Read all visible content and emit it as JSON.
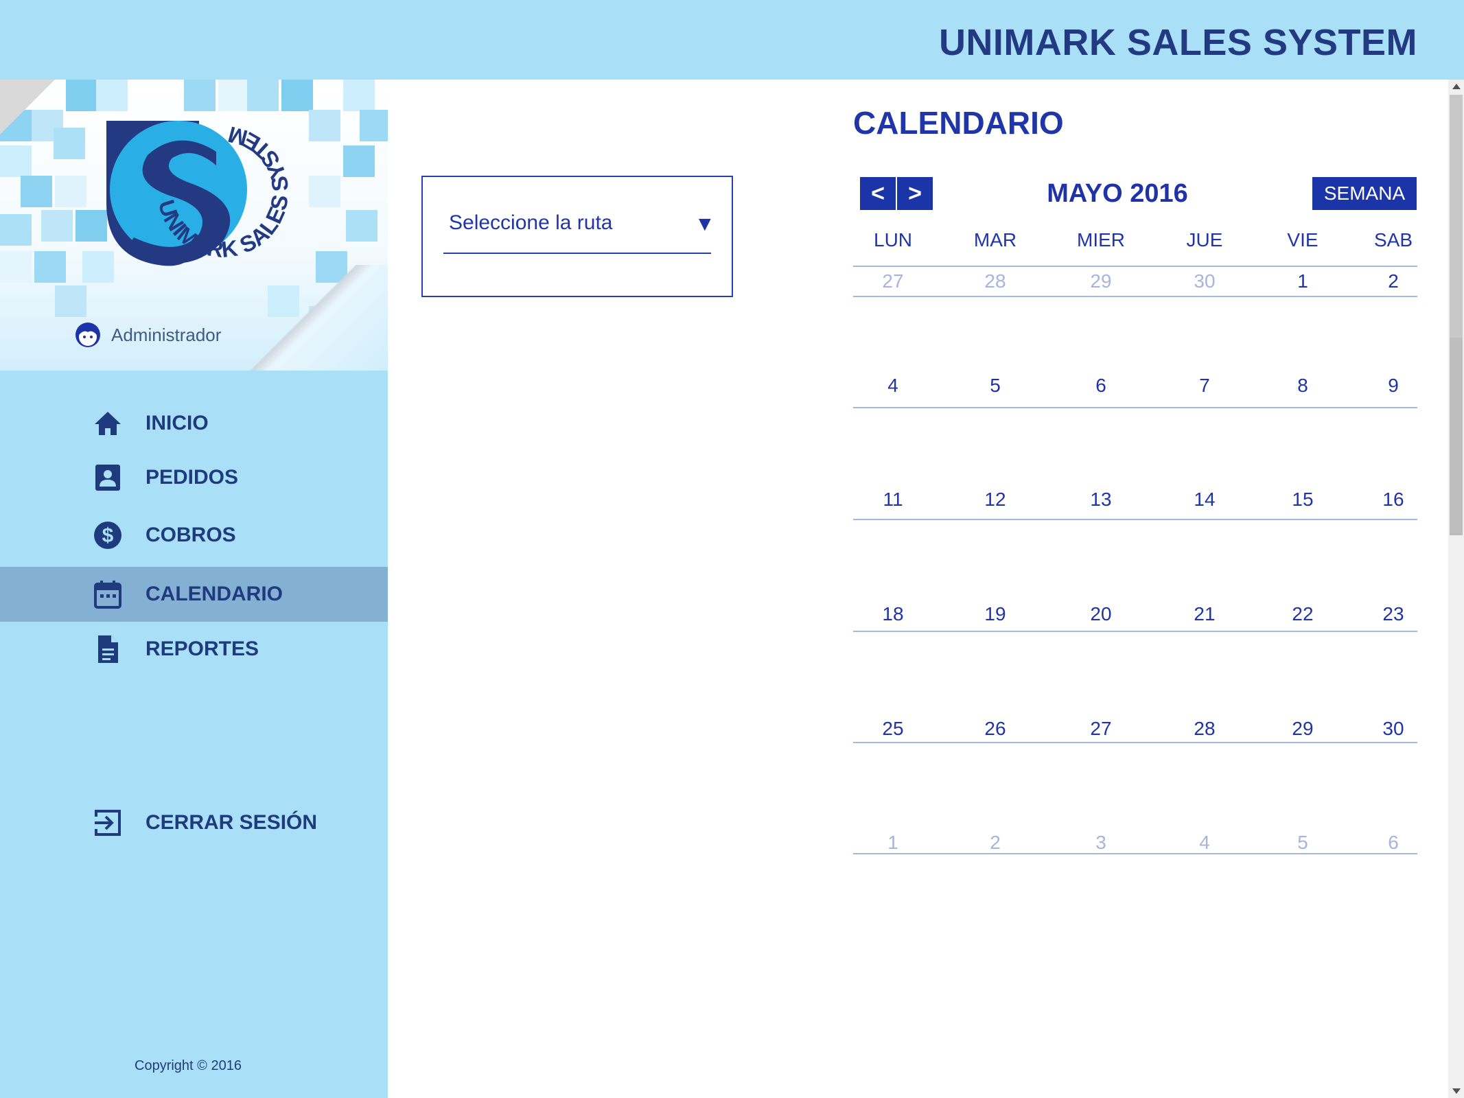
{
  "header": {
    "app_title": "UNIMARK SALES SYSTEM"
  },
  "sidebar": {
    "logo_text": "UNIMARK SALES SYSTEM",
    "user": {
      "name": "Administrador",
      "icon": "user-face-icon"
    },
    "nav": [
      {
        "label": "INICIO",
        "icon": "home-icon",
        "active": false
      },
      {
        "label": "PEDIDOS",
        "icon": "contact-card-icon",
        "active": false
      },
      {
        "label": "COBROS",
        "icon": "dollar-circle-icon",
        "active": false
      },
      {
        "label": "CALENDARIO",
        "icon": "calendar-icon",
        "active": true
      },
      {
        "label": "REPORTES",
        "icon": "document-icon",
        "active": false
      }
    ],
    "logout": {
      "label": "CERRAR SESIÓN",
      "icon": "logout-icon"
    },
    "copyright": "Copyright © 2016"
  },
  "route_select": {
    "placeholder": "Seleccione la ruta",
    "arrow": "▼"
  },
  "calendar": {
    "title": "CALENDARIO",
    "prev_label": "<",
    "next_label": ">",
    "month_label": "MAYO 2016",
    "view_button": "SEMANA",
    "weekdays": [
      "LUN",
      "MAR",
      "MIER",
      "JUE",
      "VIE",
      "SAB"
    ],
    "weeks": [
      [
        {
          "d": "27",
          "cur": false
        },
        {
          "d": "28",
          "cur": false
        },
        {
          "d": "29",
          "cur": false
        },
        {
          "d": "30",
          "cur": false
        },
        {
          "d": "1",
          "cur": true
        },
        {
          "d": "2",
          "cur": true
        }
      ],
      [
        {
          "d": "4",
          "cur": true
        },
        {
          "d": "5",
          "cur": true
        },
        {
          "d": "6",
          "cur": true
        },
        {
          "d": "7",
          "cur": true
        },
        {
          "d": "8",
          "cur": true
        },
        {
          "d": "9",
          "cur": true
        }
      ],
      [
        {
          "d": "11",
          "cur": true
        },
        {
          "d": "12",
          "cur": true
        },
        {
          "d": "13",
          "cur": true
        },
        {
          "d": "14",
          "cur": true
        },
        {
          "d": "15",
          "cur": true
        },
        {
          "d": "16",
          "cur": true
        }
      ],
      [
        {
          "d": "18",
          "cur": true
        },
        {
          "d": "19",
          "cur": true
        },
        {
          "d": "20",
          "cur": true
        },
        {
          "d": "21",
          "cur": true
        },
        {
          "d": "22",
          "cur": true
        },
        {
          "d": "23",
          "cur": true
        }
      ],
      [
        {
          "d": "25",
          "cur": true
        },
        {
          "d": "26",
          "cur": true
        },
        {
          "d": "27",
          "cur": true
        },
        {
          "d": "28",
          "cur": true
        },
        {
          "d": "29",
          "cur": true
        },
        {
          "d": "30",
          "cur": true
        }
      ],
      [
        {
          "d": "1",
          "cur": false
        },
        {
          "d": "2",
          "cur": false
        },
        {
          "d": "3",
          "cur": false
        },
        {
          "d": "4",
          "cur": false
        },
        {
          "d": "5",
          "cur": false
        },
        {
          "d": "6",
          "cur": false
        }
      ]
    ]
  },
  "colors": {
    "header_bg": "#a9e0f7",
    "sidebar_bg": "#a9e0f7",
    "active_nav_bg": "#84b0d3",
    "primary_blue": "#1b34a8",
    "dark_navy": "#233a82",
    "muted_day": "#a8b4dc"
  }
}
